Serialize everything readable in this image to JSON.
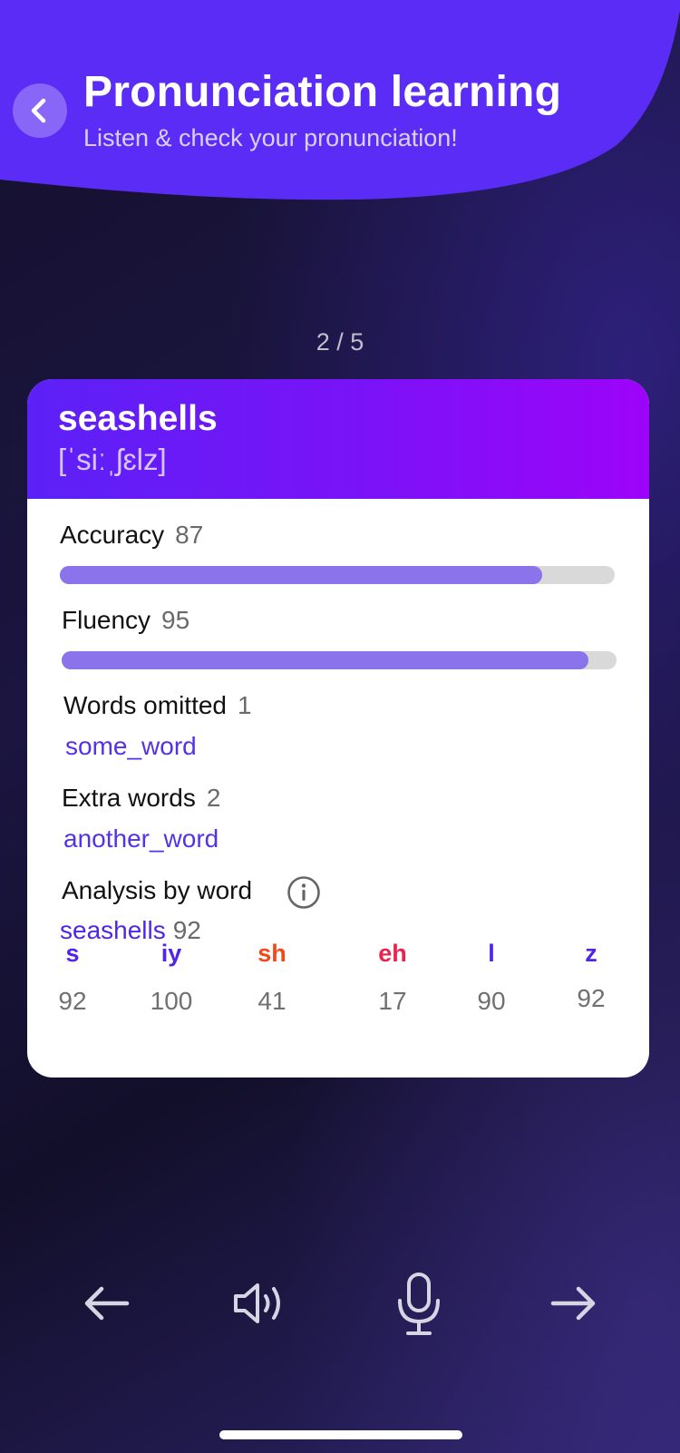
{
  "header": {
    "title": "Pronunciation learning",
    "subtitle": "Listen & check your pronunciation!",
    "back_icon": "chevron-left-icon"
  },
  "progress": "2 / 5",
  "card": {
    "word": "seashells",
    "ipa": "[ˈsiːˌʃɛlz]",
    "accuracy": {
      "label": "Accuracy",
      "value": "87",
      "fraction": 0.87
    },
    "fluency": {
      "label": "Fluency",
      "value": "95",
      "fraction": 0.95
    },
    "words_omitted": {
      "label": "Words omitted",
      "count": "1",
      "word": "some_word"
    },
    "extra_words": {
      "label": "Extra words",
      "count": "2",
      "word": "another_word"
    },
    "analysis": {
      "label": "Analysis by word",
      "word": "seashells",
      "score": "92",
      "phonemes": [
        {
          "p": "s",
          "score": "92",
          "color": "#5125e8"
        },
        {
          "p": "iy",
          "score": "100",
          "color": "#5125e8"
        },
        {
          "p": "sh",
          "score": "41",
          "color": "#f04a1c"
        },
        {
          "p": "eh",
          "score": "17",
          "color": "#e9234f"
        },
        {
          "p": "l",
          "score": "90",
          "color": "#5125e8"
        },
        {
          "p": "z",
          "score": "92",
          "color": "#5125e8"
        }
      ]
    }
  },
  "controls": {
    "prev_icon": "arrow-left-icon",
    "listen_icon": "speaker-icon",
    "record_icon": "microphone-icon",
    "next_icon": "arrow-right-icon"
  },
  "colors": {
    "accent": "#5a2cf5",
    "bar": "#8b73ec",
    "card_head_start": "#5b21f6",
    "card_head_end": "#9d04f9"
  }
}
